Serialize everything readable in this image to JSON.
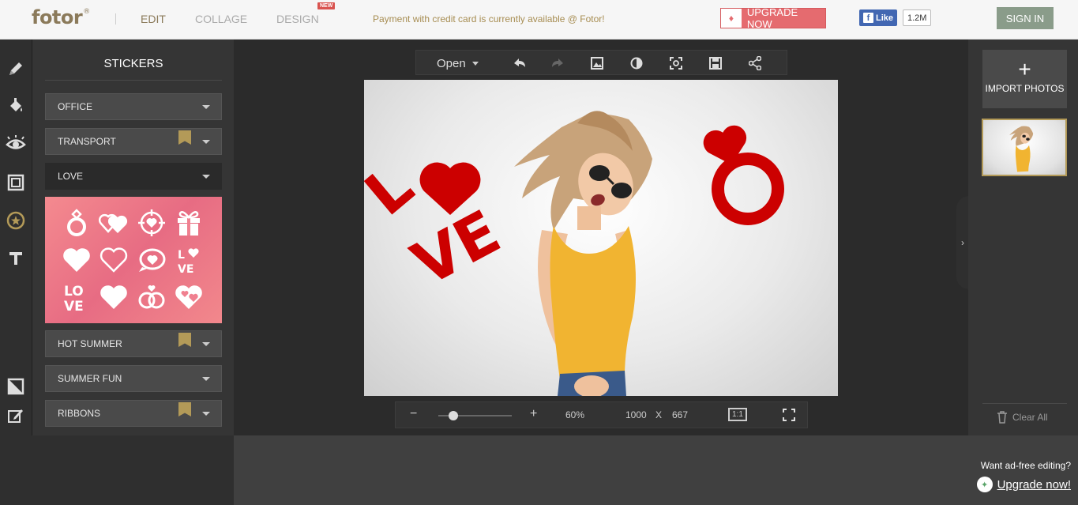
{
  "topbar": {
    "logo": "fotor",
    "logo_mark": "®",
    "nav": [
      "EDIT",
      "COLLAGE",
      "DESIGN"
    ],
    "new_badge": "NEW",
    "promo": "Payment with credit card is currently available @ Fotor!",
    "upgrade_label": "UPGRADE NOW",
    "fb_like": "Like",
    "fb_count": "1.2M",
    "signin": "SIGN IN"
  },
  "left_tools": [
    "pencil-icon",
    "paint-bucket-icon",
    "eye-icon",
    "frame-icon",
    "sticker-icon",
    "text-icon",
    "crop-half-icon",
    "edit-square-icon"
  ],
  "stickers": {
    "title": "STICKERS",
    "categories": [
      {
        "label": "OFFICE",
        "premium": false
      },
      {
        "label": "TRANSPORT",
        "premium": true
      },
      {
        "label": "LOVE",
        "premium": false,
        "open": true
      },
      {
        "label": "HOT SUMMER",
        "premium": true
      },
      {
        "label": "SUMMER FUN",
        "premium": false
      },
      {
        "label": "RIBBONS",
        "premium": true
      }
    ],
    "love_items": [
      "ring",
      "double-heart",
      "target-heart",
      "gift",
      "heart-solid",
      "heart-outline",
      "speech-heart",
      "love-text",
      "love-stacked",
      "heart-solid-2",
      "rings",
      "heart-pattern"
    ],
    "love_text_sticker": "LOVE",
    "love_stacked_lines": [
      "LO",
      "VE"
    ]
  },
  "canvas_toolbar": {
    "open_label": "Open",
    "icons": [
      "undo-icon",
      "redo-icon",
      "image-icon",
      "contrast-icon",
      "focus-icon",
      "save-icon",
      "share-icon"
    ]
  },
  "canvas": {
    "love_text": "LOVE",
    "sticker_color": "#cc0000"
  },
  "bottom_toolbar": {
    "minus": "−",
    "plus": "+",
    "zoom": "60%",
    "zoom_level": 0.2,
    "width": "1000",
    "x_sep": "X",
    "height": "667",
    "ratio_label": "1:1"
  },
  "right_panel": {
    "import_plus": "+",
    "import_label": "IMPORT PHOTOS",
    "clear_all": "Clear All",
    "collapse_glyph": "›"
  },
  "ad": {
    "question": "Want ad-free editing?",
    "link": "Upgrade now!"
  }
}
